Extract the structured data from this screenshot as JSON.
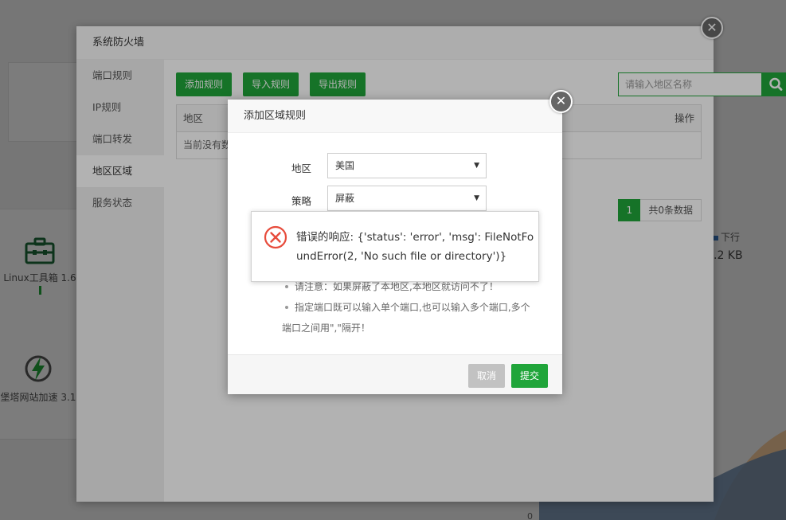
{
  "background": {
    "tools": [
      {
        "label": "Linux工具箱 1.6",
        "icon": "toolbox-icon"
      },
      {
        "label": "堡塔网站加速 3.1",
        "icon": "lightning-icon"
      }
    ],
    "legend_label": "下行",
    "speed_value": ".2 KB",
    "axis_zero": "0"
  },
  "firewall": {
    "title": "系统防火墙",
    "sidebar": [
      {
        "label": "端口规则"
      },
      {
        "label": "IP规则"
      },
      {
        "label": "端口转发"
      },
      {
        "label": "地区区域"
      },
      {
        "label": "服务状态"
      }
    ],
    "active_index": 3,
    "toolbar": {
      "add_label": "添加规则",
      "import_label": "导入规则",
      "export_label": "导出规则",
      "search_placeholder": "请输入地区名称"
    },
    "table": {
      "col_region": "地区",
      "col_actions": "操作",
      "empty_text": "当前没有数据"
    },
    "pager": {
      "current": "1",
      "total": "共0条数据"
    }
  },
  "dialog": {
    "title": "添加区域规则",
    "region_label": "地区",
    "region_value": "美国",
    "strategy_label": "策略",
    "strategy_value": "屏蔽",
    "tips": [
      "请注意：如果屏蔽了本地区,本地区就访问不了！",
      "指定端口既可以输入单个端口,也可以输入多个端口,多个",
      "端口之间用\",\"隔开！"
    ],
    "cancel_label": "取消",
    "submit_label": "提交"
  },
  "error": {
    "message": "错误的响应: {'status': 'error', 'msg': FileNotFoundError(2, 'No such file or directory')}",
    "icon": "error-circle-icon",
    "color": "#e74c3c"
  },
  "colors": {
    "accent": "#20a53a"
  }
}
